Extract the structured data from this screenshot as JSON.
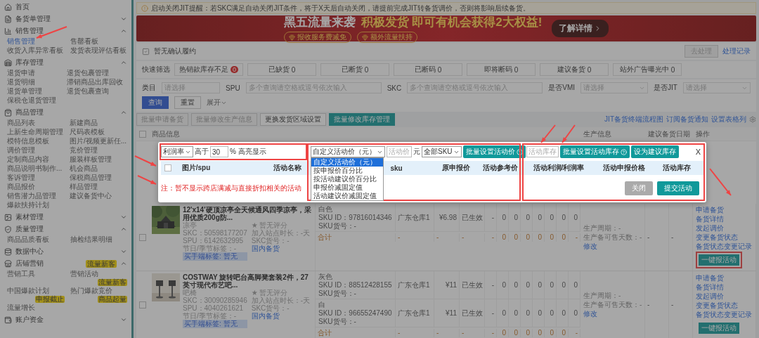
{
  "notice": "启动关闭JIT提醒：若SKC满足自动关闭JIT条件，将于X天后自动关闭，请提前完成JIT转备货调价，否则将影响后续备货。",
  "sidebar": [
    {
      "label": "首页"
    },
    {
      "label": "备货单管理",
      "expanded": false
    },
    {
      "label": "销售管理",
      "expanded": true,
      "children": [
        {
          "label": "销售管理",
          "selected": true
        },
        {
          "label": "售罄看板",
          "selected": false
        },
        {
          "label": "收货入库异常看板",
          "selected": false
        },
        {
          "label": "发货表现评估看板",
          "selected": false
        }
      ]
    },
    {
      "label": "库存管理",
      "expanded": true,
      "children": [
        {
          "label": "退货申请",
          "selected": false
        },
        {
          "label": "退货包裹管理",
          "selected": false
        },
        {
          "label": "退货明细",
          "selected": false
        },
        {
          "label": "滞销商品出库回收",
          "selected": false
        },
        {
          "label": "退货单管理",
          "selected": false
        },
        {
          "label": "退货包裹查询",
          "selected": false
        },
        {
          "label": "保税仓退货管理",
          "selected": false
        }
      ]
    },
    {
      "label": "商品管理",
      "expanded": true,
      "children": [
        {
          "label": "商品列表",
          "selected": false
        },
        {
          "label": "新建商品",
          "selected": false
        },
        {
          "label": "上新生命周期管理",
          "selected": false
        },
        {
          "label": "尺码表模板",
          "selected": false
        },
        {
          "label": "模特信息模板",
          "selected": false
        },
        {
          "label": "图片/视频更新任...",
          "selected": false
        },
        {
          "label": "调价管理",
          "selected": false
        },
        {
          "label": "竞价管理",
          "selected": false
        },
        {
          "label": "定制商品内容",
          "selected": false
        },
        {
          "label": "服装样板管理",
          "selected": false
        },
        {
          "label": "商品说明书制作...",
          "selected": false
        },
        {
          "label": "机会商品",
          "selected": false
        },
        {
          "label": "客诉管理",
          "selected": false
        },
        {
          "label": "保税商品管理",
          "selected": false
        },
        {
          "label": "商品报价",
          "selected": false
        },
        {
          "label": "样品管理",
          "selected": false
        },
        {
          "label": "销售潜力品管理",
          "selected": false
        },
        {
          "label": "建议备货中心",
          "selected": false
        },
        {
          "label": "爆款扶持计划",
          "selected": false
        }
      ]
    },
    {
      "label": "素材管理",
      "expanded": false
    },
    {
      "label": "质量管理",
      "expanded": true,
      "children": [
        {
          "label": "商品品质看板",
          "selected": false
        },
        {
          "label": "抽检结果明细",
          "selected": false
        }
      ]
    },
    {
      "label": "数据中心",
      "expanded": false
    },
    {
      "label": "店铺营销",
      "expanded": true,
      "badge": "流量新客",
      "children": [
        {
          "label": "营销工具",
          "selected": false
        },
        {
          "label": "营销活动",
          "selected": false,
          "badge": "流量新客"
        },
        {
          "label": "中国爆款计划",
          "selected": false,
          "badge": "申报截止"
        },
        {
          "label": "热门爆款竞价",
          "selected": false,
          "badge": "商品起量"
        },
        {
          "label": "流量增长",
          "selected": false
        }
      ]
    },
    {
      "label": "账户资金",
      "expanded": false
    }
  ],
  "banner": {
    "headline": "黑五流量来袭",
    "slogan": "积极发货 即可有机会获得2大权益!",
    "perks": [
      "报收服务费减免",
      "额外流量扶持"
    ],
    "button": "了解详情"
  },
  "confirm_bar": {
    "title": "暂无确认履约",
    "process_button": {
      "label": "去处理",
      "disabled": true
    },
    "history_link": "处理记录"
  },
  "quick_filter": {
    "label": "快速筛选",
    "chips": [
      {
        "label": "热销款库存不足",
        "count": "0",
        "alert": true
      },
      {
        "label": "已缺货",
        "count": "0",
        "alert": false
      },
      {
        "label": "已断货",
        "count": "0",
        "alert": false
      },
      {
        "label": "已断码",
        "count": "0",
        "alert": false
      },
      {
        "label": "即将断码",
        "count": "0",
        "alert": false
      },
      {
        "label": "建议备货",
        "count": "0",
        "alert": false
      },
      {
        "label": "站外广告曝光中",
        "count": "0",
        "alert": false
      }
    ]
  },
  "search_form": {
    "fields": [
      {
        "label": "类目",
        "placeholder": "请选择",
        "kind": "input"
      },
      {
        "label": "SPU",
        "placeholder": "多个查询请空格或逗号依次输入",
        "kind": "input"
      },
      {
        "label": "SKC",
        "placeholder": "多个查询请空格或逗号依次输入",
        "kind": "input"
      },
      {
        "label": "是否VMI",
        "placeholder": "请选择",
        "kind": "select"
      },
      {
        "label": "是否JIT",
        "placeholder": "请选择",
        "kind": "select"
      }
    ],
    "buttons": [
      {
        "label": "查询",
        "primary": true
      },
      {
        "label": "重置",
        "primary": false
      }
    ],
    "expand": "展开"
  },
  "toolbar": {
    "buttons": [
      {
        "label": "批量申请备货",
        "kind": "muted"
      },
      {
        "label": "批量修改生产信息",
        "kind": "muted"
      },
      {
        "label": "更换发货区域设置",
        "kind": "outline"
      },
      {
        "label": "批量修改库存管理",
        "kind": "teal"
      }
    ],
    "links": [
      "JIT备货终端流程图",
      "订阅备货通知",
      "设置表格列"
    ]
  },
  "table": {
    "select_all_checked": false,
    "columns": [
      "商品信息",
      "生产信息",
      "建议备货日期",
      "操作"
    ],
    "products": [
      {
        "kind": "tent",
        "checked": false,
        "title": "12'x14'硬顶凉亭全天候通风四季凉亭，采用优质200g防...",
        "category": "凉亭",
        "rating": "★ 暂无评分",
        "meta": [
          "SKC：50598177207",
          "加入站点时长：-天",
          "SPU：6142632995",
          "SKC货号：-",
          "节日/季节标签：-"
        ],
        "tag": "国内备货",
        "buyer_tag": "买手端标签: 暂无",
        "skus": [
          {
            "variant": "白色",
            "sku_id": "SKU ID：97816014346",
            "sku_code": "SKU货号：-",
            "warehouse": "广东仓库1",
            "price": "¥6.98",
            "status": "已生效",
            "values": [
              "-",
              "0",
              "0",
              "0",
              "0",
              "0",
              "0",
              "0"
            ]
          }
        ],
        "total": {
          "label": "合计",
          "values": [
            "-",
            "-",
            "-",
            "-",
            "0",
            "0",
            "0",
            "0",
            "0",
            "0",
            "-"
          ]
        },
        "production": [
          "生产周期：-",
          "生产备可售天数：-"
        ],
        "edit": "修改",
        "blanks": [
          "-",
          "-"
        ],
        "actions": [
          "申请备货",
          "备货详情",
          "发起调价",
          "变更备货状态",
          "备货状态变更记录"
        ],
        "activity_button": "一键报活动",
        "annotated": true
      },
      {
        "kind": "chairs",
        "checked": false,
        "title": "COSTWAY 旋转吧台高脚凳套装2件，27英寸现代布艺吧...",
        "category": "吧椅",
        "rating": "★ 暂无评分",
        "meta": [
          "SKC：30090285946",
          "加入站点时长：-天",
          "SPU：4040261621",
          "SKC货号：-",
          "节日/季节标签：-"
        ],
        "tag": "国内备货",
        "buyer_tag": "买手端标签: 暂无",
        "skus": [
          {
            "variant": "灰色",
            "sku_id": "SKU ID：88512428155",
            "sku_code": "SKU货号：-",
            "warehouse": "广东仓库1",
            "price": "¥11",
            "status": "已生效",
            "values": [
              "-",
              "0",
              "0",
              "0",
              "0",
              "0",
              "0",
              "0"
            ]
          },
          {
            "variant": "白",
            "sku_id": "SKU ID：96655247490",
            "sku_code": "SKU货号：-",
            "warehouse": "广东仓库1",
            "price": "¥11",
            "status": "已生效",
            "values": [
              "-",
              "0",
              "0",
              "0",
              "0",
              "0",
              "0",
              "0"
            ]
          }
        ],
        "total": {
          "label": "合计",
          "values": [
            "-",
            "-",
            "-",
            "-",
            "0",
            "0",
            "0",
            "0",
            "0",
            "0",
            "-"
          ]
        },
        "production": [
          "生产周期：-",
          "生产备可售天数：-"
        ],
        "edit": "修改",
        "blanks": [
          "-",
          "-"
        ],
        "actions": [
          "申请备货",
          "备货详情",
          "发起调价",
          "变更备货状态",
          "备货状态变更记录"
        ],
        "activity_button": "一键报活动",
        "annotated": false
      }
    ]
  },
  "modal": {
    "threshold": {
      "metric": "利润率",
      "above": "高于",
      "value": "30",
      "suffix": "% 高亮显示"
    },
    "price_mode": {
      "value": "自定义活动价（元）",
      "open": true,
      "options": [
        {
          "label": "自定义活动价（元）",
          "selected": true
        },
        {
          "label": "按申报价百分比",
          "selected": false
        },
        {
          "label": "按活动建议价百分比",
          "selected": false
        },
        {
          "label": "申报价减固定值",
          "selected": false
        },
        {
          "label": "活动建议价减固定值",
          "selected": false
        }
      ]
    },
    "price_placeholder": "活动价",
    "unit": "元",
    "sku_scope": "全部SKU",
    "batch_price_button": "批量设置活动价",
    "stock_placeholder": "活动库存",
    "batch_stock_button": "批量设置活动库存",
    "suggest_stock_button": "设为建议库存",
    "close_mark": "X",
    "select_all_checked": false,
    "columns": [
      "图片/spu",
      "活动名称",
      "sku",
      "原申报价",
      "活动参考价",
      "活动利润/利润率",
      "活动申报价格",
      "活动库存"
    ],
    "note": "注：暂不显示跨店满减与直接折扣相关的活动",
    "buttons": [
      {
        "label": "关闭",
        "kind": "secondary"
      },
      {
        "label": "提交活动",
        "kind": "primary"
      }
    ]
  }
}
